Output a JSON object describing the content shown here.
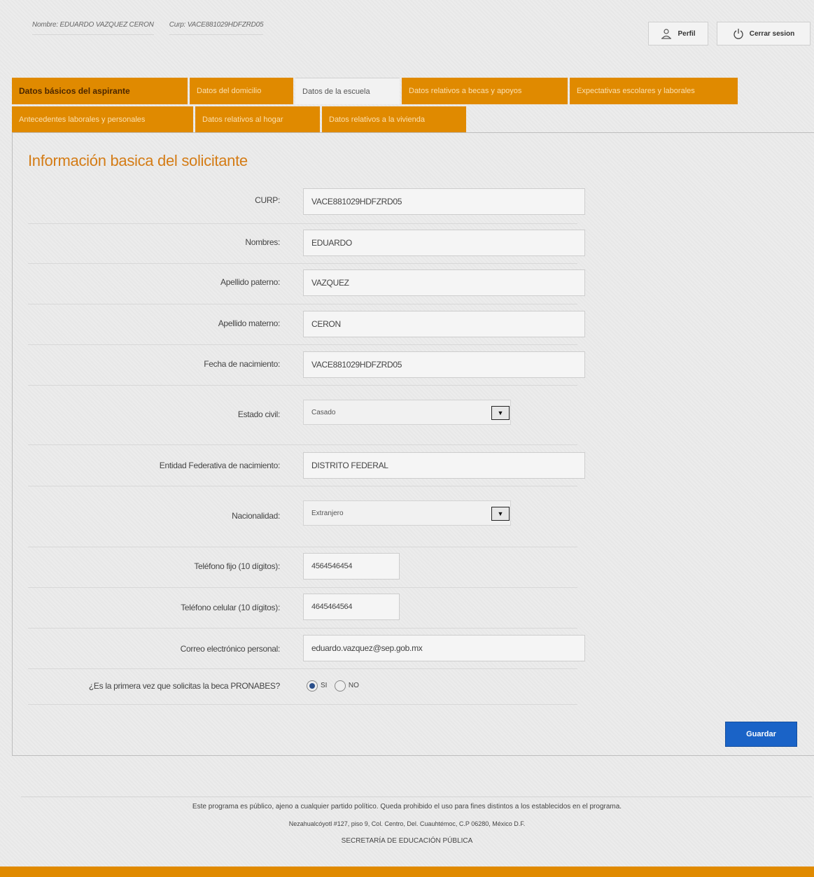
{
  "header": {
    "user_name": "Nombre: EDUARDO VAZQUEZ CERON",
    "curp": "Curp: VACE881029HDFZRD05",
    "profile_label": "Perfil",
    "logout_label": "Cerrar sesion"
  },
  "tabs": {
    "row1": [
      "Datos básicos del aspirante",
      "Datos del domicilio",
      "Datos de la escuela",
      "Datos relativos a becas y apoyos",
      "Expectativas escolares y laborales"
    ],
    "row2": [
      "Antecedentes laborales y personales",
      "Datos relativos al hogar",
      "Datos relativos a la vivienda"
    ]
  },
  "form": {
    "title": "Información basica del solicitante",
    "curp": {
      "label": "CURP:",
      "value": "VACE881029HDFZRD05"
    },
    "nombres": {
      "label": "Nombres:",
      "value": "EDUARDO"
    },
    "apellido_paterno": {
      "label": "Apellido paterno:",
      "value": "VAZQUEZ"
    },
    "apellido_materno": {
      "label": "Apellido materno:",
      "value": "CERON"
    },
    "fecha_nacimiento": {
      "label": "Fecha de nacimiento:",
      "value": "VACE881029HDFZRD05"
    },
    "estado_civil": {
      "label": "Estado civil:",
      "value": "Casado"
    },
    "entidad": {
      "label": "Entidad Federativa de nacimiento:",
      "value": "DISTRITO FEDERAL"
    },
    "nacionalidad": {
      "label": "Nacionalidad:",
      "value": "Extranjero"
    },
    "telefono_fijo": {
      "label": "Teléfono fijo (10 dígitos):",
      "value": "4564546454"
    },
    "telefono_celular": {
      "label": "Teléfono celular (10 dígitos):",
      "value": "4645464564"
    },
    "correo": {
      "label": "Correo electrónico personal:",
      "value": "eduardo.vazquez@sep.gob.mx"
    },
    "primera_vez": {
      "label": "¿Es la primera vez que solicitas la beca PRONABES?",
      "option_yes": "SI",
      "option_no": "NO",
      "selected": "SI"
    },
    "save_label": "Guardar"
  },
  "footer": {
    "line1": "Este programa es público, ajeno a cualquier partido político. Queda prohibido el uso para fines distintos a los establecidos en el programa.",
    "line2": "Nezahualcóyotl #127, piso 9, Col. Centro, Del. Cuauhtémoc, C.P 06280, México D.F.",
    "line3": "SECRETARÍA DE EDUCACIÓN PÚBLICA"
  }
}
